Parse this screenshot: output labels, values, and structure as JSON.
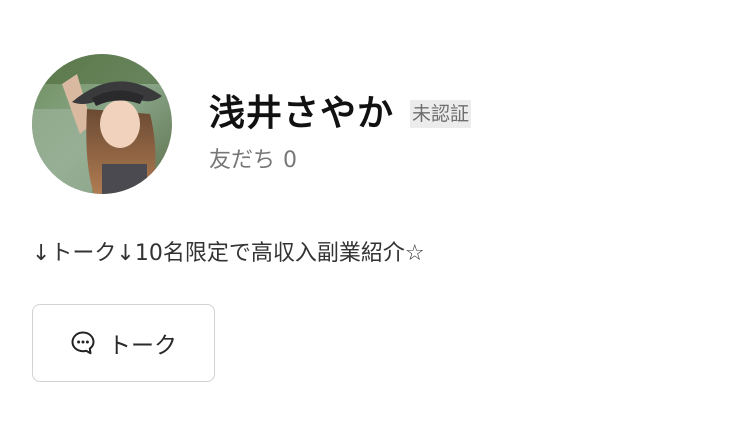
{
  "profile": {
    "display_name": "浅井さやか",
    "verification_badge": "未認証",
    "friends_label": "友だち",
    "friends_count": "0",
    "bio": "↓トーク↓10名限定で高収入副業紹介☆",
    "avatar_icon": "profile-photo"
  },
  "actions": {
    "talk_label": "トーク",
    "talk_icon": "chat-bubble-icon"
  }
}
